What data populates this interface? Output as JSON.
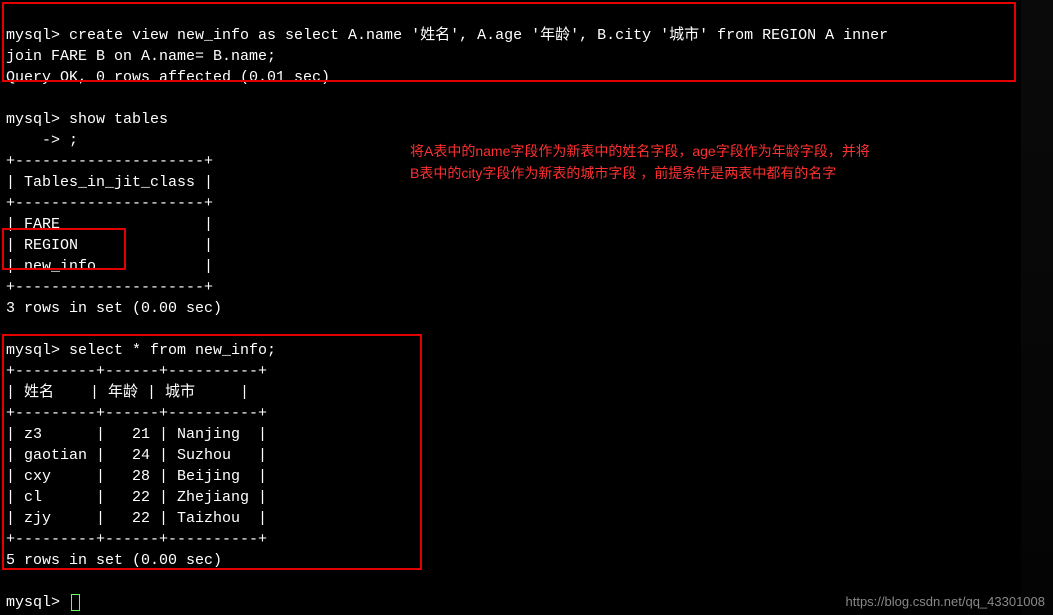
{
  "prompt": "mysql>",
  "cont_prompt": "    ->",
  "sql": {
    "create_view_line1": "mysql> create view new_info as select A.name '姓名', A.age '年龄', B.city '城市' from REGION A inner",
    "create_view_line2": "join FARE B on A.name= B.name;",
    "create_result": "Query OK, 0 rows affected (0.01 sec)",
    "show_tables": "mysql> show tables",
    "show_tables_cont": "    -> ;",
    "tables_sep": "+---------------------+",
    "tables_header": "| Tables_in_jit_class |",
    "table_rows": [
      "| FARE                |",
      "| REGION              |",
      "| new_info            |"
    ],
    "tables_rowcount": "3 rows in set (0.00 sec)",
    "select_stmt": "mysql> select * from new_info;",
    "ni_sep": "+---------+------+----------+",
    "ni_header": "| 姓名    | 年龄 | 城市     |",
    "ni_rows": [
      "| z3      |   21 | Nanjing  |",
      "| gaotian |   24 | Suzhou   |",
      "| cxy     |   28 | Beijing  |",
      "| cl      |   22 | Zhejiang |",
      "| zjy     |   22 | Taizhou  |"
    ],
    "ni_rowcount": "5 rows in set (0.00 sec)",
    "final_prompt": "mysql> "
  },
  "annotation": {
    "line1": "将A表中的name字段作为新表中的姓名字段，age字段作为年龄字段，并将",
    "line2": "B表中的city字段作为新表的城市字段 ，前提条件是两表中都有的名字"
  },
  "watermark": "https://blog.csdn.net/qq_43301008",
  "chart_data": {
    "type": "table",
    "tables": [
      {
        "name": "Tables_in_jit_class",
        "columns": [
          "Tables_in_jit_class"
        ],
        "rows": [
          [
            "FARE"
          ],
          [
            "REGION"
          ],
          [
            "new_info"
          ]
        ]
      },
      {
        "name": "new_info",
        "columns": [
          "姓名",
          "年龄",
          "城市"
        ],
        "rows": [
          [
            "z3",
            21,
            "Nanjing"
          ],
          [
            "gaotian",
            24,
            "Suzhou"
          ],
          [
            "cxy",
            28,
            "Beijing"
          ],
          [
            "cl",
            22,
            "Zhejiang"
          ],
          [
            "zjy",
            22,
            "Taizhou"
          ]
        ]
      }
    ]
  }
}
